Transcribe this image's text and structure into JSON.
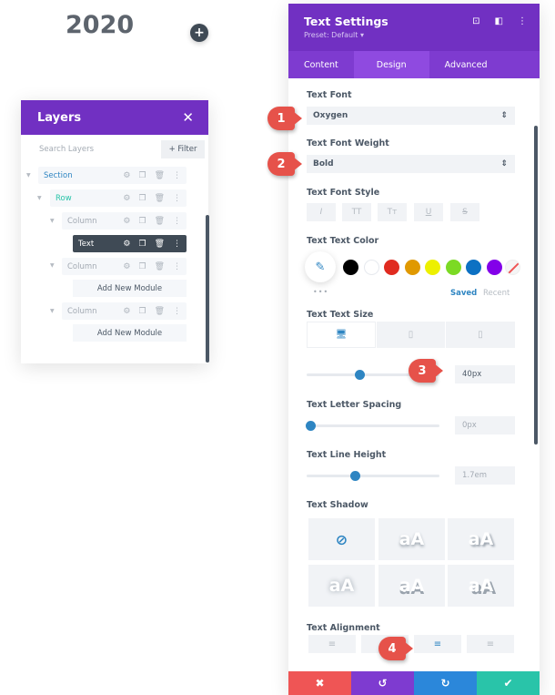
{
  "canvas": {
    "heading": "2020",
    "add_icon": "+"
  },
  "layers": {
    "title": "Layers",
    "close_icon": "✕",
    "search_placeholder": "Search Layers",
    "filter_label": "+ Filter",
    "tree": [
      {
        "label": "Section",
        "type": "section"
      },
      {
        "label": "Row",
        "type": "row"
      },
      {
        "label": "Column",
        "type": "column"
      },
      {
        "label": "Text",
        "type": "text",
        "selected": true
      },
      {
        "label": "Column",
        "type": "column"
      },
      {
        "label": "Column",
        "type": "column"
      }
    ],
    "add_module_label": "Add New Module"
  },
  "settings": {
    "title": "Text Settings",
    "preset": "Preset: Default ▾",
    "tabs": [
      "Content",
      "Design",
      "Advanced"
    ],
    "active_tab": "Design",
    "text_font": {
      "label": "Text Font",
      "value": "Oxygen"
    },
    "text_font_weight": {
      "label": "Text Font Weight",
      "value": "Bold"
    },
    "text_font_style": {
      "label": "Text Font Style",
      "buttons": [
        "I",
        "TT",
        "Tт",
        "U",
        "S"
      ]
    },
    "text_color": {
      "label": "Text Text Color",
      "swatches": [
        "#000000",
        "#ffffff",
        "#e02b20",
        "#e09900",
        "#edf000",
        "#7cda24",
        "#0c71c3",
        "#8300e9"
      ],
      "saved_label": "Saved",
      "recent_label": "Recent",
      "more": "•••"
    },
    "text_size": {
      "label": "Text Text Size",
      "value": "40px",
      "slider_fraction": 0.4
    },
    "letter_spacing": {
      "label": "Text Letter Spacing",
      "value": "0px",
      "slider_fraction": 0.03
    },
    "line_height": {
      "label": "Text Line Height",
      "value": "1.7em",
      "slider_fraction": 0.36
    },
    "text_shadow": {
      "label": "Text Shadow",
      "tile_text": "aA",
      "none_icon": "⊘"
    },
    "text_alignment": {
      "label": "Text Alignment",
      "active_index": 2
    },
    "footer": {
      "cancel": "✖",
      "undo": "↺",
      "redo": "↻",
      "save": "✔"
    },
    "colors": {
      "cancel": "#ef5555",
      "undo": "#7e3bd0",
      "redo": "#2b87da",
      "save": "#29c4a9"
    }
  },
  "markers": [
    "1",
    "2",
    "3",
    "4"
  ]
}
